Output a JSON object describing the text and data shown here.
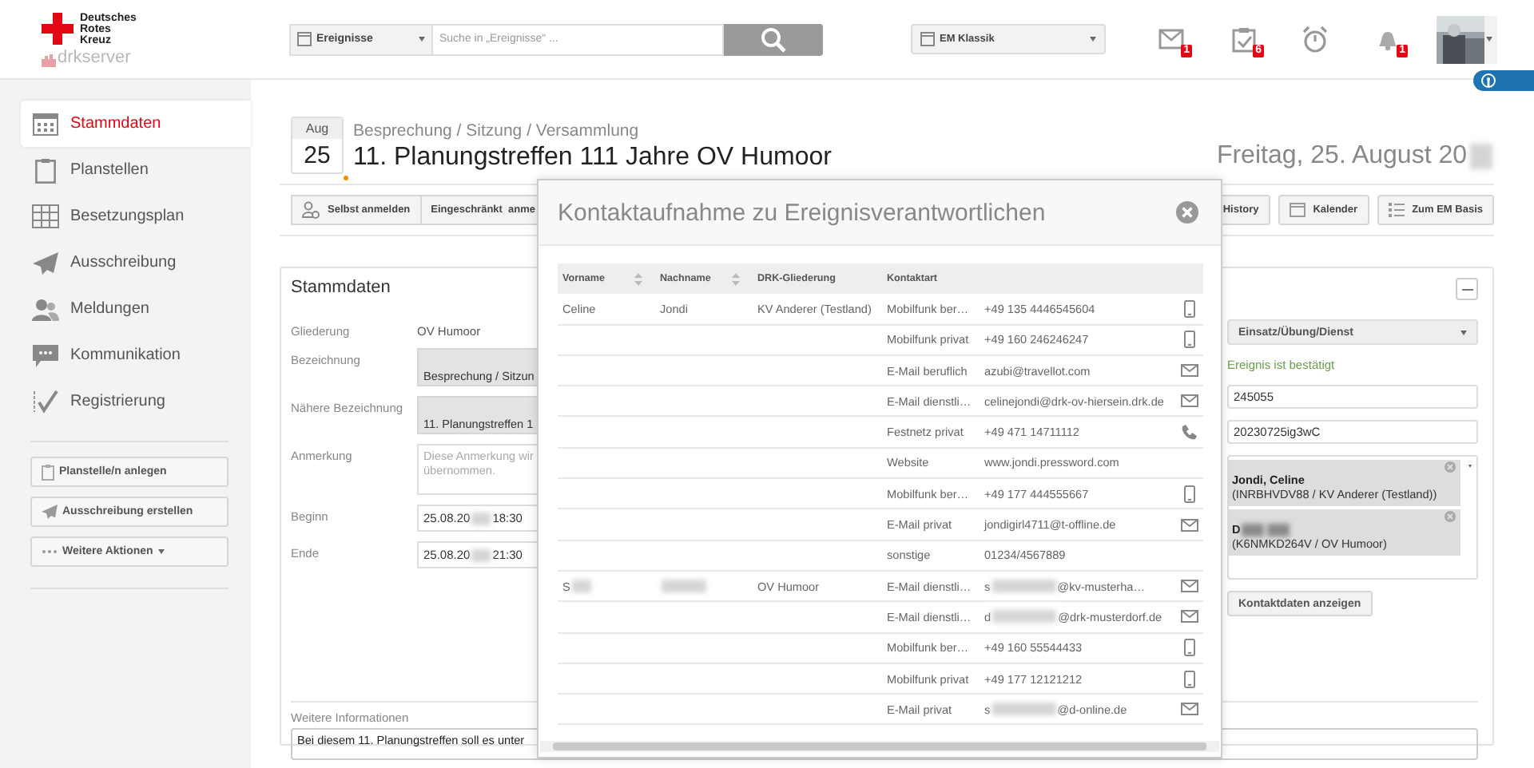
{
  "header": {
    "logo_lines": [
      "Deutsches",
      "Rotes",
      "Kreuz"
    ],
    "product": "drkserver",
    "search": {
      "scope": "Ereignisse",
      "placeholder": "Suche in „Ereignisse“ ..."
    },
    "view_select": "EM Klassik",
    "notifications": [
      {
        "kind": "mail",
        "badge": "1"
      },
      {
        "kind": "tasks",
        "badge": "6"
      },
      {
        "kind": "timer"
      },
      {
        "kind": "bell",
        "badge": "1"
      }
    ]
  },
  "sidebar": {
    "items": [
      {
        "label": "Stammdaten",
        "selected": true
      },
      {
        "label": "Planstellen",
        "selected": false
      },
      {
        "label": "Besetzungsplan",
        "selected": false
      },
      {
        "label": "Ausschreibung",
        "selected": false
      },
      {
        "label": "Meldungen",
        "selected": false
      },
      {
        "label": "Kommunikation",
        "selected": false
      },
      {
        "label": "Registrierung",
        "selected": false
      }
    ],
    "actions": [
      "Planstelle/n anlegen",
      "Ausschreibung erstellen",
      "Weitere Aktionen"
    ]
  },
  "event": {
    "month": "Aug",
    "day": "25",
    "category": "Besprechung / Sitzung / Versammlung",
    "title": "11. Planungstreffen 111 Jahre OV Humoor",
    "date": "Freitag, 25. August 20",
    "date_redacted": true,
    "toolbar": [
      "Selbst anmelden",
      "Eingeschränkt  anme",
      "History",
      "Kalender",
      "Zum EM Basis"
    ]
  },
  "panel": {
    "title": "Stammdaten",
    "fields": [
      {
        "label": "Gliederung",
        "kind": "text",
        "value": "OV Humoor"
      },
      {
        "label": "Bezeichnung",
        "kind": "readonly",
        "value": "Besprechung / Sitzun"
      },
      {
        "label": "Nähere Bezeichnung",
        "kind": "readonly",
        "value": "11. Planungstreffen 1"
      },
      {
        "label": "Anmerkung",
        "kind": "textarea",
        "placeholder": "Diese Anmerkung wir\nübernommen."
      },
      {
        "label": "Beginn",
        "kind": "input",
        "value_parts": [
          "25.08.20",
          "18:30"
        ]
      },
      {
        "label": "Ende",
        "kind": "input",
        "value_parts": [
          "25.08.20",
          "21:30"
        ]
      }
    ],
    "type_select": "Einsatz/Übung/Dienst",
    "status": "Ereignis ist bestätigt",
    "numbers": [
      "245055",
      "20230725ig3wC"
    ],
    "responsibles": [
      {
        "name": "Jondi, Celine",
        "name_redacted": false,
        "detail": "(INRBHVDV88 / KV Anderer (Testland))"
      },
      {
        "name": "D",
        "name_redacted": true,
        "detail": "(K6NMKD264V / OV Humoor)"
      }
    ],
    "contact_button": "Kontaktdaten anzeigen",
    "info_label": "Weitere Informationen",
    "info_value": "Bei diesem 11. Planungstreffen soll es unter"
  },
  "modal": {
    "title": "Kontaktaufnahme zu Ereignisverantwortlichen",
    "columns": [
      {
        "label": "Vorname",
        "sortable": true
      },
      {
        "label": "Nachname",
        "sortable": true
      },
      {
        "label": "DRK-Gliederung",
        "sortable": false
      },
      {
        "label": "Kontaktart",
        "sortable": false
      }
    ],
    "rows": [
      {
        "first": "Celine",
        "last": "Jondi",
        "org": "KV Anderer (Testland)",
        "type": "Mobilfunk ber…",
        "value_parts": [
          "+49 135 4446545604"
        ],
        "kind": "mobile"
      },
      {
        "type": "Mobilfunk privat",
        "value_parts": [
          "+49 160 246246247"
        ],
        "kind": "mobile"
      },
      {
        "type": "E-Mail beruflich",
        "value_parts": [
          "azubi@travellot.com"
        ],
        "kind": "mail"
      },
      {
        "type": "E-Mail dienstli…",
        "value_parts": [
          "celinejondi@drk-ov-hiersein.drk.de"
        ],
        "kind": "mail"
      },
      {
        "type": "Festnetz privat",
        "value_parts": [
          "+49 471 14711112"
        ],
        "kind": "phone"
      },
      {
        "type": "Website",
        "value_parts": [
          "www.jondi.pressword.com"
        ],
        "kind": "web"
      },
      {
        "type": "Mobilfunk ber…",
        "value_parts": [
          "+49 177 444555667"
        ],
        "kind": "mobile"
      },
      {
        "type": "E-Mail privat",
        "value_parts": [
          "jondigirl4711@t-offline.de"
        ],
        "kind": "mail"
      },
      {
        "type": "sonstige",
        "value_parts": [
          "01234/4567889"
        ],
        "kind": "other"
      },
      {
        "first": "S",
        "name_redacted": true,
        "org": "OV Humoor",
        "type": "E-Mail dienstli…",
        "value_parts": [
          "s",
          "@kv-musterha…"
        ],
        "kind": "mail"
      },
      {
        "type": "E-Mail dienstli…",
        "value_parts": [
          "d",
          "@drk-musterdorf.de"
        ],
        "kind": "mail"
      },
      {
        "type": "Mobilfunk ber…",
        "value_parts": [
          "+49 160 55544433"
        ],
        "kind": "mobile"
      },
      {
        "type": "Mobilfunk privat",
        "value_parts": [
          "+49 177 12121212"
        ],
        "kind": "mobile"
      },
      {
        "type": "E-Mail privat",
        "value_parts": [
          "s",
          "@d-online.de"
        ],
        "kind": "mail"
      }
    ]
  }
}
